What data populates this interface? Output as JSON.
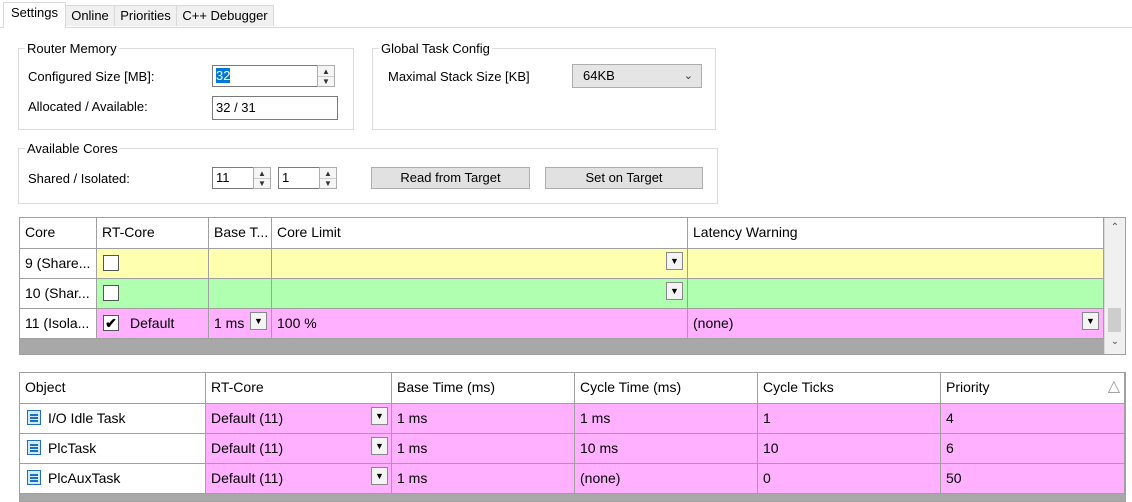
{
  "tabs": [
    {
      "label": "Settings",
      "active": true
    },
    {
      "label": "Online",
      "active": false
    },
    {
      "label": "Priorities",
      "active": false
    },
    {
      "label": "C++ Debugger",
      "active": false
    }
  ],
  "router_memory": {
    "title": "Router Memory",
    "configured_label": "Configured Size [MB]:",
    "configured_value": "32",
    "allocated_label": "Allocated / Available:",
    "allocated_value": "32 / 31"
  },
  "global_task_config": {
    "title": "Global Task Config",
    "stack_label": "Maximal Stack Size [KB]",
    "stack_value": "64KB"
  },
  "available_cores": {
    "title": "Available Cores",
    "shared_label": "Shared / Isolated:",
    "shared_value": "11",
    "isolated_value": "1",
    "read_button": "Read from Target",
    "set_button": "Set on Target"
  },
  "core_grid": {
    "headers": [
      "Core",
      "RT-Core",
      "Base T...",
      "Core Limit",
      "Latency Warning"
    ],
    "rows": [
      {
        "core": "9 (Share...",
        "rt_core": "",
        "checked": false,
        "base_time": "",
        "core_limit": "",
        "latency": "",
        "color": "#ffffb0"
      },
      {
        "core": "10 (Shar...",
        "rt_core": "",
        "checked": false,
        "base_time": "",
        "core_limit": "",
        "latency": "",
        "color": "#b0ffb0"
      },
      {
        "core": "11 (Isola...",
        "rt_core": "Default",
        "checked": true,
        "base_time": "1 ms",
        "core_limit": "100 %",
        "latency": "(none)",
        "color": "#ffb0ff"
      }
    ]
  },
  "task_grid": {
    "headers": [
      "Object",
      "RT-Core",
      "Base Time (ms)",
      "Cycle Time (ms)",
      "Cycle Ticks",
      "Priority"
    ],
    "rows": [
      {
        "object": "I/O Idle Task",
        "rt_core": "Default (11)",
        "base_time": "1 ms",
        "cycle_time": "1 ms",
        "cycle_ticks": "1",
        "priority": "4"
      },
      {
        "object": "PlcTask",
        "rt_core": "Default (11)",
        "base_time": "1 ms",
        "cycle_time": "10 ms",
        "cycle_ticks": "10",
        "priority": "6"
      },
      {
        "object": "PlcAuxTask",
        "rt_core": "Default (11)",
        "base_time": "1 ms",
        "cycle_time": "(none)",
        "cycle_ticks": "0",
        "priority": "50"
      }
    ]
  },
  "icons": {
    "spin": "spin-arrows-icon",
    "dropdown": "dropdown-arrow-icon",
    "task": "task-icon",
    "sort": "sort-ascending-icon",
    "check": "checkmark-icon"
  },
  "colors": {
    "yellow_row": "#ffffb0",
    "green_row": "#b0ffb0",
    "pink_row": "#ffb0ff",
    "selection": "#0078d7"
  }
}
